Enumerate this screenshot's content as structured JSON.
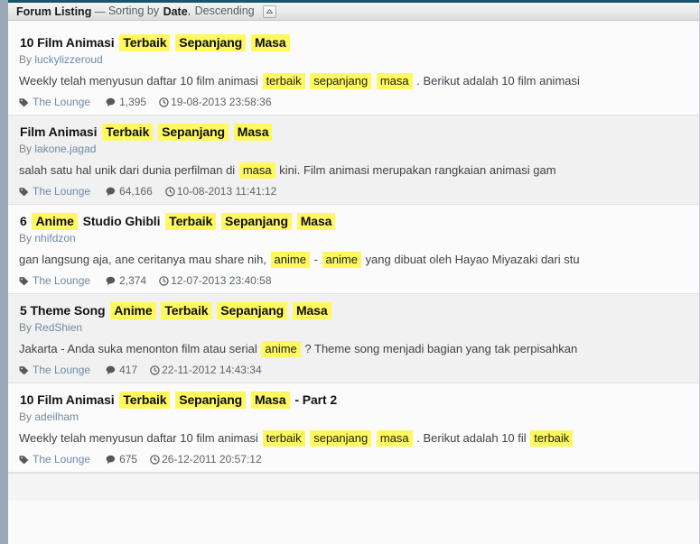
{
  "header": {
    "title": "Forum Listing",
    "dash": "—",
    "sort_prefix": "Sorting by",
    "sort_field": "Date",
    "sort_comma": ",",
    "sort_direction": "Descending",
    "collapse_icon": "chevron-up-icon",
    "collapse_glyph": "▲"
  },
  "colors": {
    "highlight": "#fff95e",
    "link": "#6d8aa6",
    "header_top_border": "#15566b",
    "left_rail": "#9aa7b4"
  },
  "icons": {
    "tag": "tag-icon",
    "comment": "comment-icon",
    "clock": "clock-icon"
  },
  "meta_labels": {
    "by": "By"
  },
  "posts": [
    {
      "title_parts": [
        {
          "text": "10 Film Animasi",
          "highlight": false
        },
        {
          "text": "Terbaik",
          "highlight": true
        },
        {
          "text": "Sepanjang",
          "highlight": true
        },
        {
          "text": "Masa",
          "highlight": true
        }
      ],
      "author": "luckylizzeroud",
      "snippet_parts": [
        {
          "text": "Weekly telah menyusun daftar 10 film animasi ",
          "highlight": false
        },
        {
          "text": "terbaik",
          "highlight": true
        },
        {
          "text": " ",
          "highlight": false
        },
        {
          "text": "sepanjang",
          "highlight": true
        },
        {
          "text": " ",
          "highlight": false
        },
        {
          "text": "masa",
          "highlight": true
        },
        {
          "text": " . Berikut adalah 10 film animasi",
          "highlight": false
        }
      ],
      "forum": "The Lounge",
      "replies": "1,395",
      "date": "19-08-2013 23:58:36"
    },
    {
      "title_parts": [
        {
          "text": "Film Animasi",
          "highlight": false
        },
        {
          "text": "Terbaik",
          "highlight": true
        },
        {
          "text": "Sepanjang",
          "highlight": true
        },
        {
          "text": "Masa",
          "highlight": true
        }
      ],
      "author": "lakone.jagad",
      "snippet_parts": [
        {
          "text": "salah satu hal unik dari dunia perfilman di ",
          "highlight": false
        },
        {
          "text": "masa",
          "highlight": true
        },
        {
          "text": " kini. Film animasi merupakan rangkaian animasi gam",
          "highlight": false
        }
      ],
      "forum": "The Lounge",
      "replies": "64,166",
      "date": "10-08-2013 11:41:12"
    },
    {
      "title_parts": [
        {
          "text": "6",
          "highlight": false
        },
        {
          "text": "Anime",
          "highlight": true
        },
        {
          "text": "Studio Ghibli",
          "highlight": false
        },
        {
          "text": "Terbaik",
          "highlight": true
        },
        {
          "text": "Sepanjang",
          "highlight": true
        },
        {
          "text": "Masa",
          "highlight": true
        }
      ],
      "author": "nhifdzon",
      "snippet_parts": [
        {
          "text": "gan langsung aja, ane ceritanya mau share nih, ",
          "highlight": false
        },
        {
          "text": "anime",
          "highlight": true
        },
        {
          "text": " - ",
          "highlight": false
        },
        {
          "text": "anime",
          "highlight": true
        },
        {
          "text": " yang dibuat oleh Hayao Miyazaki dari stu",
          "highlight": false
        }
      ],
      "forum": "The Lounge",
      "replies": "2,374",
      "date": "12-07-2013 23:40:58"
    },
    {
      "title_parts": [
        {
          "text": "5 Theme Song",
          "highlight": false
        },
        {
          "text": "Anime",
          "highlight": true
        },
        {
          "text": "Terbaik",
          "highlight": true
        },
        {
          "text": "Sepanjang",
          "highlight": true
        },
        {
          "text": "Masa",
          "highlight": true
        }
      ],
      "author": "RedShien",
      "snippet_parts": [
        {
          "text": "Jakarta - Anda suka menonton film atau serial ",
          "highlight": false
        },
        {
          "text": "anime",
          "highlight": true
        },
        {
          "text": " ? Theme song menjadi bagian yang tak perpisahkan",
          "highlight": false
        }
      ],
      "forum": "The Lounge",
      "replies": "417",
      "date": "22-11-2012 14:43:34"
    },
    {
      "title_parts": [
        {
          "text": "10 Film Animasi",
          "highlight": false
        },
        {
          "text": "Terbaik",
          "highlight": true
        },
        {
          "text": "Sepanjang",
          "highlight": true
        },
        {
          "text": "Masa",
          "highlight": true
        },
        {
          "text": "- Part 2",
          "highlight": false
        }
      ],
      "author": "adeilham",
      "snippet_parts": [
        {
          "text": "Weekly telah menyusun daftar 10 film animasi ",
          "highlight": false
        },
        {
          "text": "terbaik",
          "highlight": true
        },
        {
          "text": " ",
          "highlight": false
        },
        {
          "text": "sepanjang",
          "highlight": true
        },
        {
          "text": " ",
          "highlight": false
        },
        {
          "text": "masa",
          "highlight": true
        },
        {
          "text": " . Berikut adalah 10 fil ",
          "highlight": false
        },
        {
          "text": "terbaik",
          "highlight": true
        }
      ],
      "forum": "The Lounge",
      "replies": "675",
      "date": "26-12-2011 20:57:12"
    }
  ]
}
